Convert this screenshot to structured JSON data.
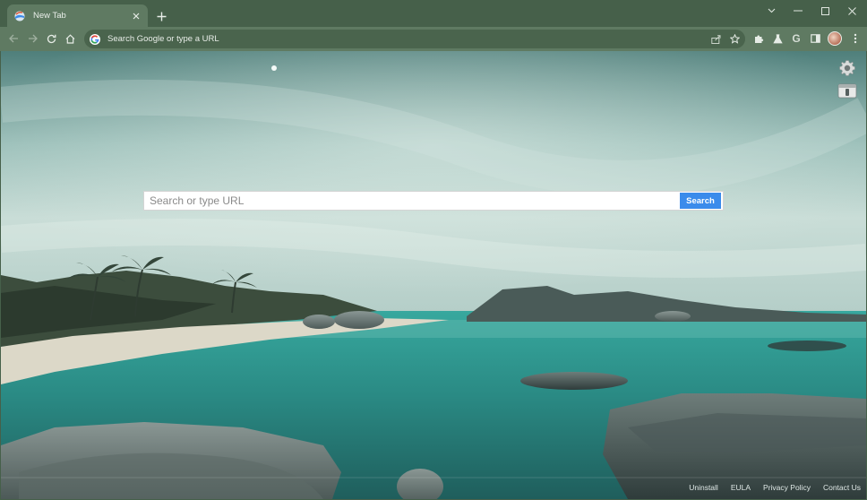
{
  "browser": {
    "tab": {
      "title": "New Tab"
    },
    "toolbar": {
      "omnibox_text": "Search Google or type a URL",
      "extension_letter": "G"
    }
  },
  "page": {
    "search": {
      "placeholder": "Search or type URL",
      "button_label": "Search"
    },
    "footer": {
      "links": [
        "Uninstall",
        "EULA",
        "Privacy Policy",
        "Contact Us"
      ]
    }
  },
  "colors": {
    "titlebar": "#46604a",
    "toolbar": "#5f7a62",
    "search_button": "#3b8beb",
    "sea": "#2f9a92"
  },
  "icons": [
    "favicon-icon",
    "close-icon",
    "plus-icon",
    "minimize-icon",
    "maximize-icon",
    "window-close-icon",
    "back-icon",
    "forward-icon",
    "reload-icon",
    "home-icon",
    "google-icon",
    "share-icon",
    "star-icon",
    "puzzle-icon",
    "flask-icon",
    "side-panel-icon",
    "menu-icon",
    "gear-icon",
    "card-icon"
  ]
}
